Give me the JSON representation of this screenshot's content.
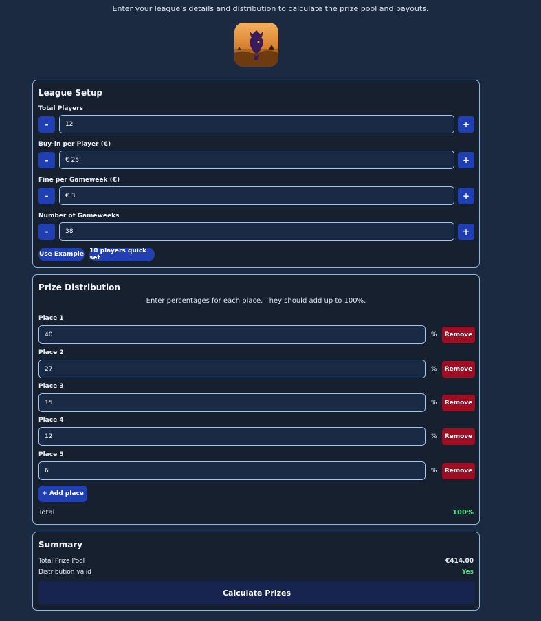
{
  "header": {
    "subtitle": "Enter your league's details and distribution to calculate the prize pool and payouts."
  },
  "logo": {
    "icon": "premier-league-lion-logo-icon"
  },
  "league_setup": {
    "title": "League Setup",
    "fields": [
      {
        "label": "Total Players",
        "value": "12",
        "minus": "-",
        "plus": "+"
      },
      {
        "label": "Buy-in per Player (€)",
        "value": "€  25",
        "minus": "-",
        "plus": "+"
      },
      {
        "label": "Fine per Gameweek (€)",
        "value": "€  3",
        "minus": "-",
        "plus": "+"
      },
      {
        "label": "Number of Gameweeks",
        "value": "38",
        "minus": "-",
        "plus": "+"
      }
    ],
    "quick_buttons": [
      "Use Example",
      "10 players quick set"
    ]
  },
  "prize_distribution": {
    "title": "Prize Distribution",
    "description": "Enter percentages for each place. They should add up to 100%.",
    "percent_symbol": "%",
    "remove_label": "Remove",
    "places": [
      {
        "label": "Place 1",
        "value": "40"
      },
      {
        "label": "Place 2",
        "value": "27"
      },
      {
        "label": "Place 3",
        "value": "15"
      },
      {
        "label": "Place 4",
        "value": "12"
      },
      {
        "label": "Place 5",
        "value": "6"
      }
    ],
    "add_label": "+ Add place",
    "total_label": "Total",
    "total_value": "100%"
  },
  "summary": {
    "title": "Summary",
    "prize_pool_label": "Total Prize Pool",
    "prize_pool_value": "€414.00",
    "valid_label": "Distribution valid",
    "valid_value": "Yes",
    "calculate_label": "Calculate Prizes"
  },
  "colors": {
    "background": "#1b2a40",
    "card": "#16202f",
    "card_border": "#8db9e6",
    "primary_button": "#1f3fb3",
    "remove_button": "#9e0d22",
    "success": "#4ade80"
  }
}
